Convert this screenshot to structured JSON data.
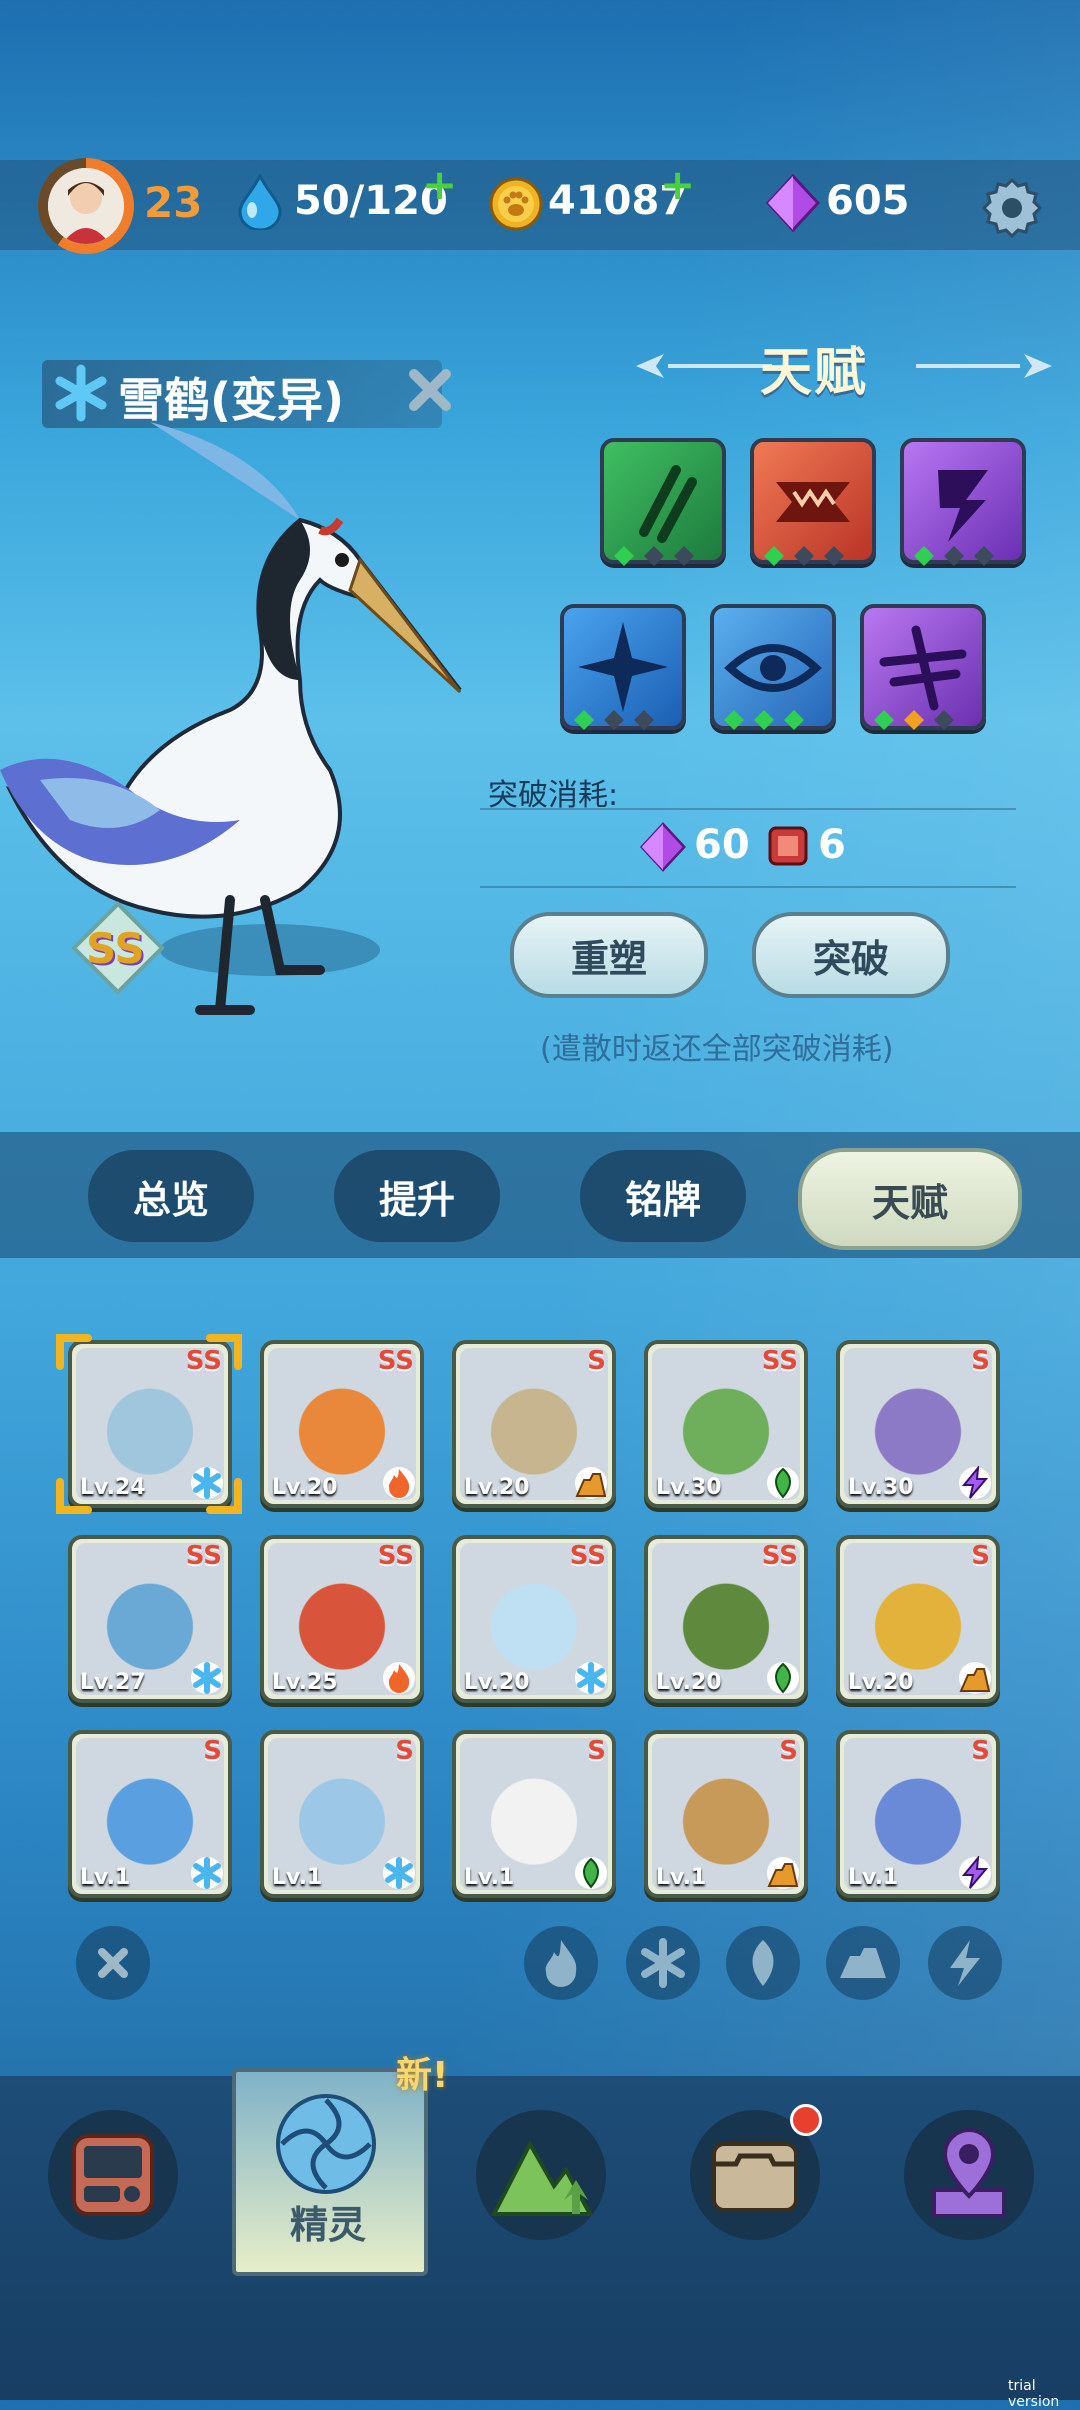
{
  "player": {
    "level": "23"
  },
  "resources": {
    "energy": "50/120",
    "coins": "41087",
    "gems": "605"
  },
  "pet": {
    "name": "雪鹤(变异)",
    "rank": "SS"
  },
  "talent": {
    "title": "天赋",
    "cost_label": "突破消耗:",
    "cost_gems": "60",
    "cost_items": "6",
    "reset_label": "重塑",
    "break_label": "突破",
    "note": "(遣散时返还全部突破消耗)"
  },
  "tabs": [
    {
      "label": "总览"
    },
    {
      "label": "提升"
    },
    {
      "label": "铭牌"
    },
    {
      "label": "天赋",
      "active": true
    }
  ],
  "pets": [
    {
      "lv": "Lv.24",
      "rank": "SS",
      "element": "ice",
      "color": "#9fc6dc"
    },
    {
      "lv": "Lv.20",
      "rank": "SS",
      "element": "fire",
      "color": "#e9873b"
    },
    {
      "lv": "Lv.20",
      "rank": "S",
      "element": "earth",
      "color": "#c7b58f"
    },
    {
      "lv": "Lv.30",
      "rank": "SS",
      "element": "wood",
      "color": "#6fae5a"
    },
    {
      "lv": "Lv.30",
      "rank": "S",
      "element": "thunder",
      "color": "#8c7ac7"
    },
    {
      "lv": "Lv.27",
      "rank": "SS",
      "element": "ice",
      "color": "#6aa8d6"
    },
    {
      "lv": "Lv.25",
      "rank": "SS",
      "element": "fire",
      "color": "#d8553c"
    },
    {
      "lv": "Lv.20",
      "rank": "SS",
      "element": "ice",
      "color": "#bfe0f2"
    },
    {
      "lv": "Lv.20",
      "rank": "SS",
      "element": "wood",
      "color": "#5f8a3e"
    },
    {
      "lv": "Lv.20",
      "rank": "S",
      "element": "earth",
      "color": "#e2b23a"
    },
    {
      "lv": "Lv.1",
      "rank": "S",
      "element": "ice",
      "color": "#5aa0e0"
    },
    {
      "lv": "Lv.1",
      "rank": "S",
      "element": "ice",
      "color": "#9cc7e6"
    },
    {
      "lv": "Lv.1",
      "rank": "S",
      "element": "wood",
      "color": "#f2f2f2"
    },
    {
      "lv": "Lv.1",
      "rank": "S",
      "element": "earth",
      "color": "#c89a5a"
    },
    {
      "lv": "Lv.1",
      "rank": "S",
      "element": "thunder",
      "color": "#6a8ad8"
    }
  ],
  "nav": {
    "pet_label": "精灵",
    "new_tag": "新!"
  },
  "watermark": "trial version"
}
